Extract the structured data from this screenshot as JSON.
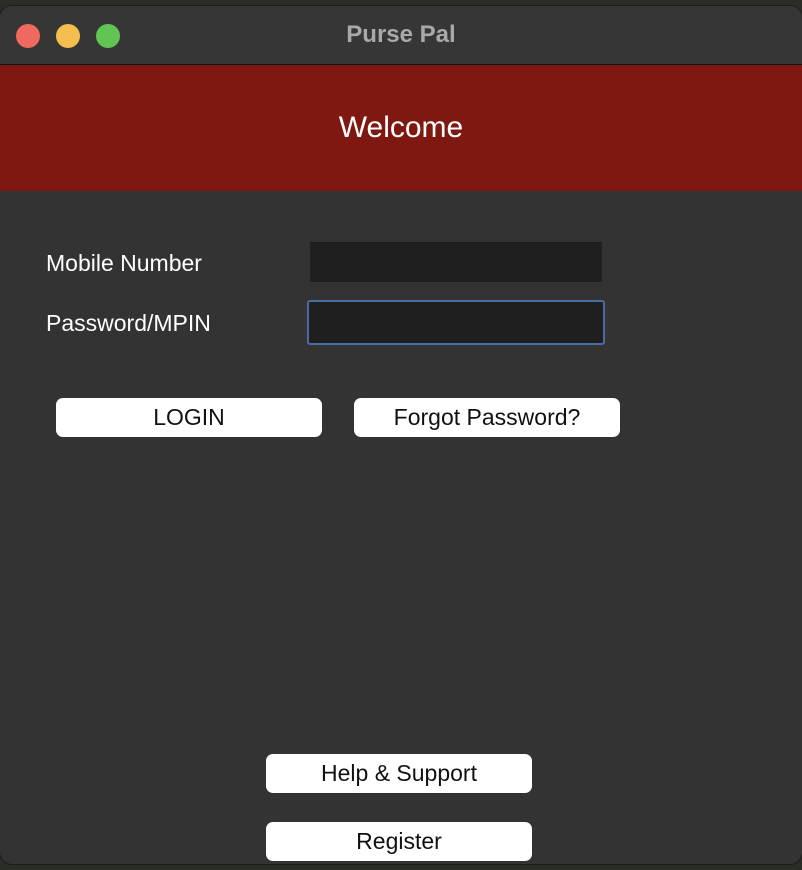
{
  "window": {
    "title": "Purse Pal"
  },
  "banner": {
    "text": "Welcome"
  },
  "form": {
    "mobile_label": "Mobile Number",
    "mobile_value": "",
    "password_label": "Password/MPIN",
    "password_value": ""
  },
  "buttons": {
    "login": "LOGIN",
    "forgot": "Forgot Password?",
    "help": "Help & Support",
    "register": "Register"
  },
  "colors": {
    "banner": "#7e1810",
    "background": "#333333",
    "focus_ring": "#4a6da0"
  }
}
